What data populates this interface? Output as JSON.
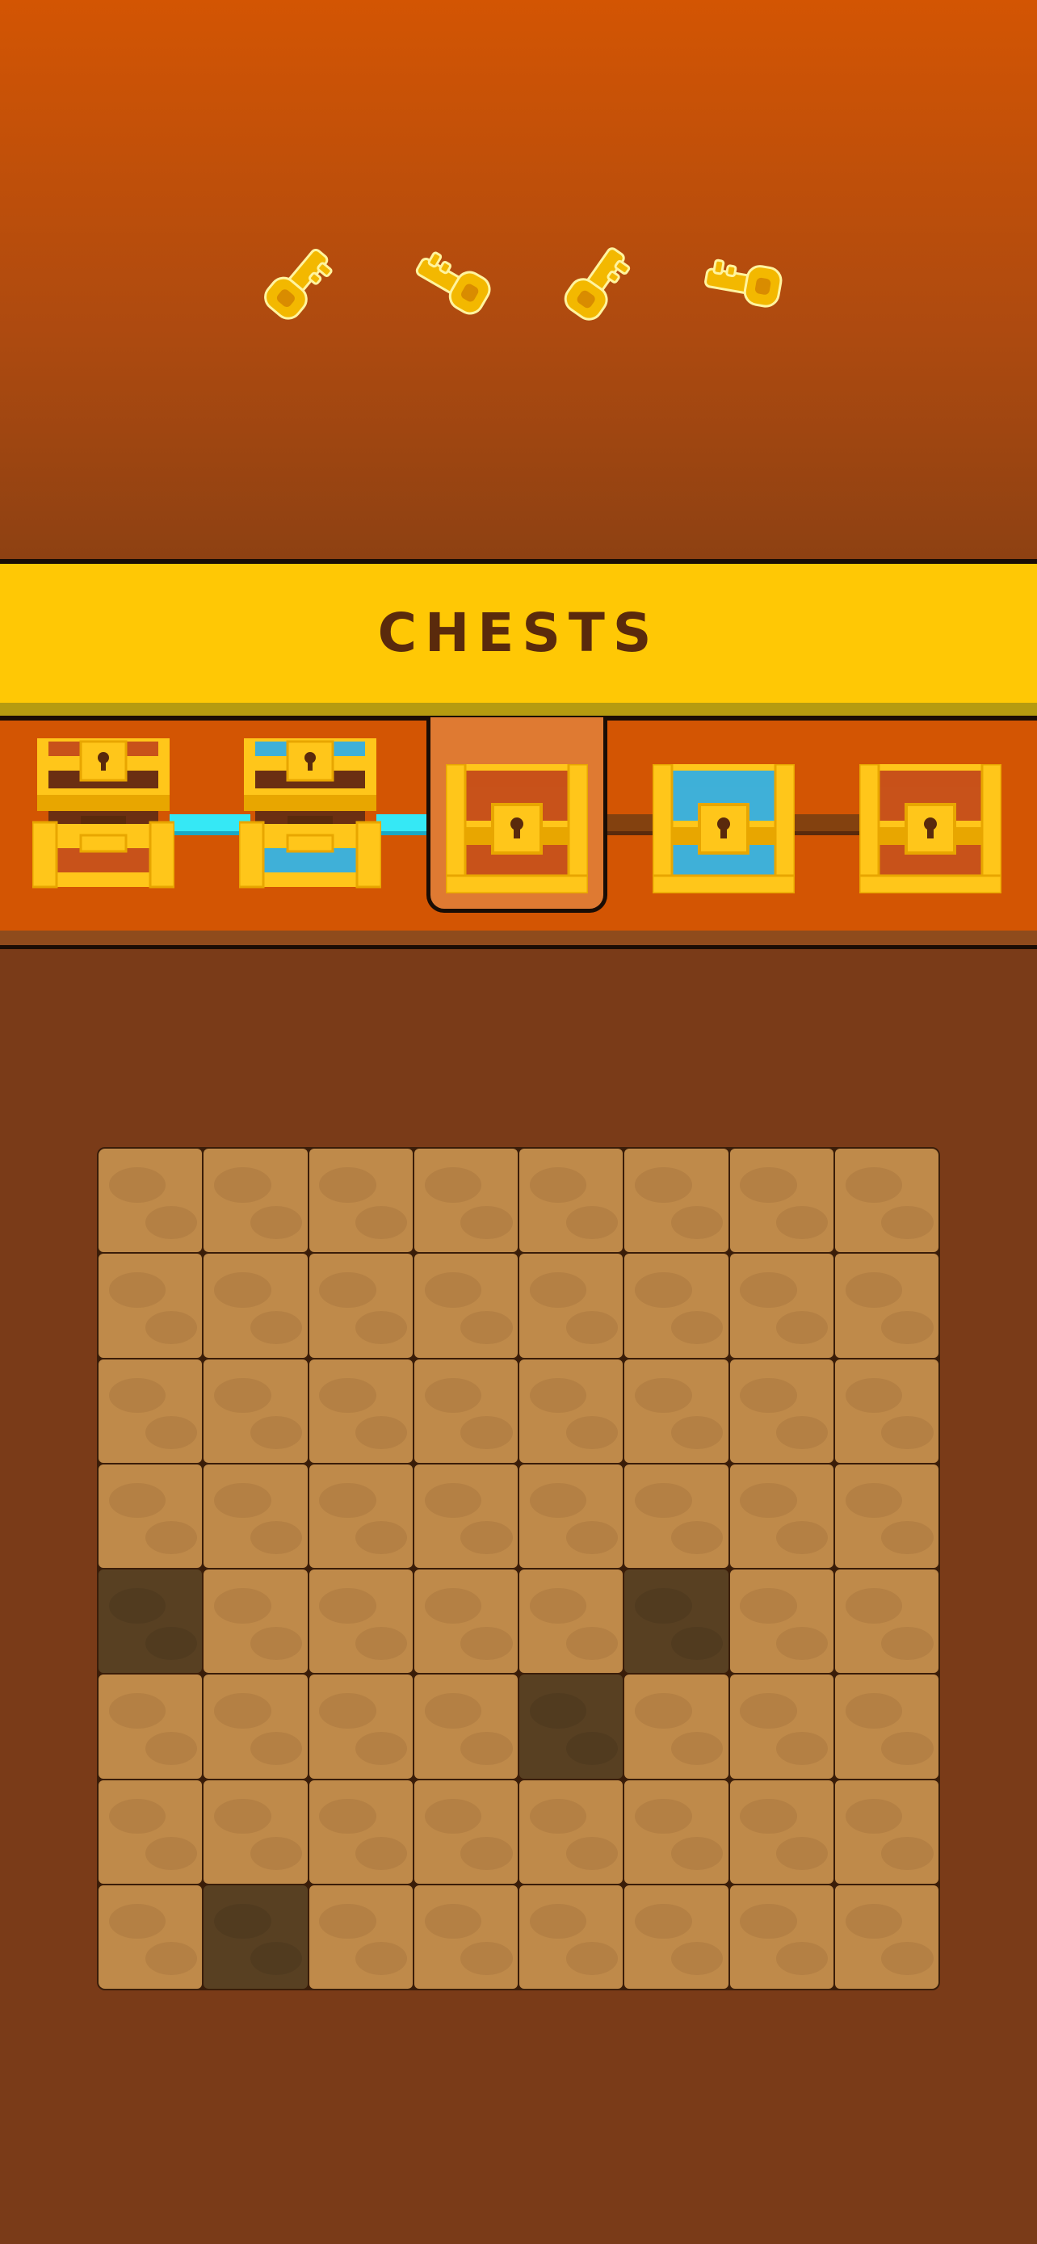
{
  "banner": {
    "title": "CHESTS"
  },
  "keys": [
    {
      "icon": "gold-key-icon"
    },
    {
      "icon": "gold-key-icon"
    },
    {
      "icon": "gold-key-icon"
    },
    {
      "icon": "gold-key-icon"
    }
  ],
  "chests": [
    {
      "icon": "open-red-chest-icon",
      "state": "opened",
      "color": "#c8521a"
    },
    {
      "icon": "open-blue-chest-icon",
      "state": "opened",
      "color": "#3fb0d8"
    },
    {
      "icon": "closed-red-chest-icon",
      "state": "current",
      "color": "#c8521a"
    },
    {
      "icon": "closed-blue-chest-icon",
      "state": "locked",
      "color": "#3fb0d8"
    },
    {
      "icon": "closed-red-chest-icon",
      "state": "locked",
      "color": "#c8521a"
    }
  ],
  "board": {
    "rows": 8,
    "cols": 8,
    "hole_cells": [
      [
        4,
        0
      ],
      [
        4,
        5
      ],
      [
        5,
        4
      ],
      [
        7,
        1
      ]
    ]
  },
  "colors": {
    "background": "#7a3b18",
    "header": "#d35503",
    "banner": "#ffc805",
    "banner_text": "#5a2a0c",
    "tile": "#bf8a4a",
    "hole": "#584022",
    "progress_done": "#35e8f5"
  }
}
